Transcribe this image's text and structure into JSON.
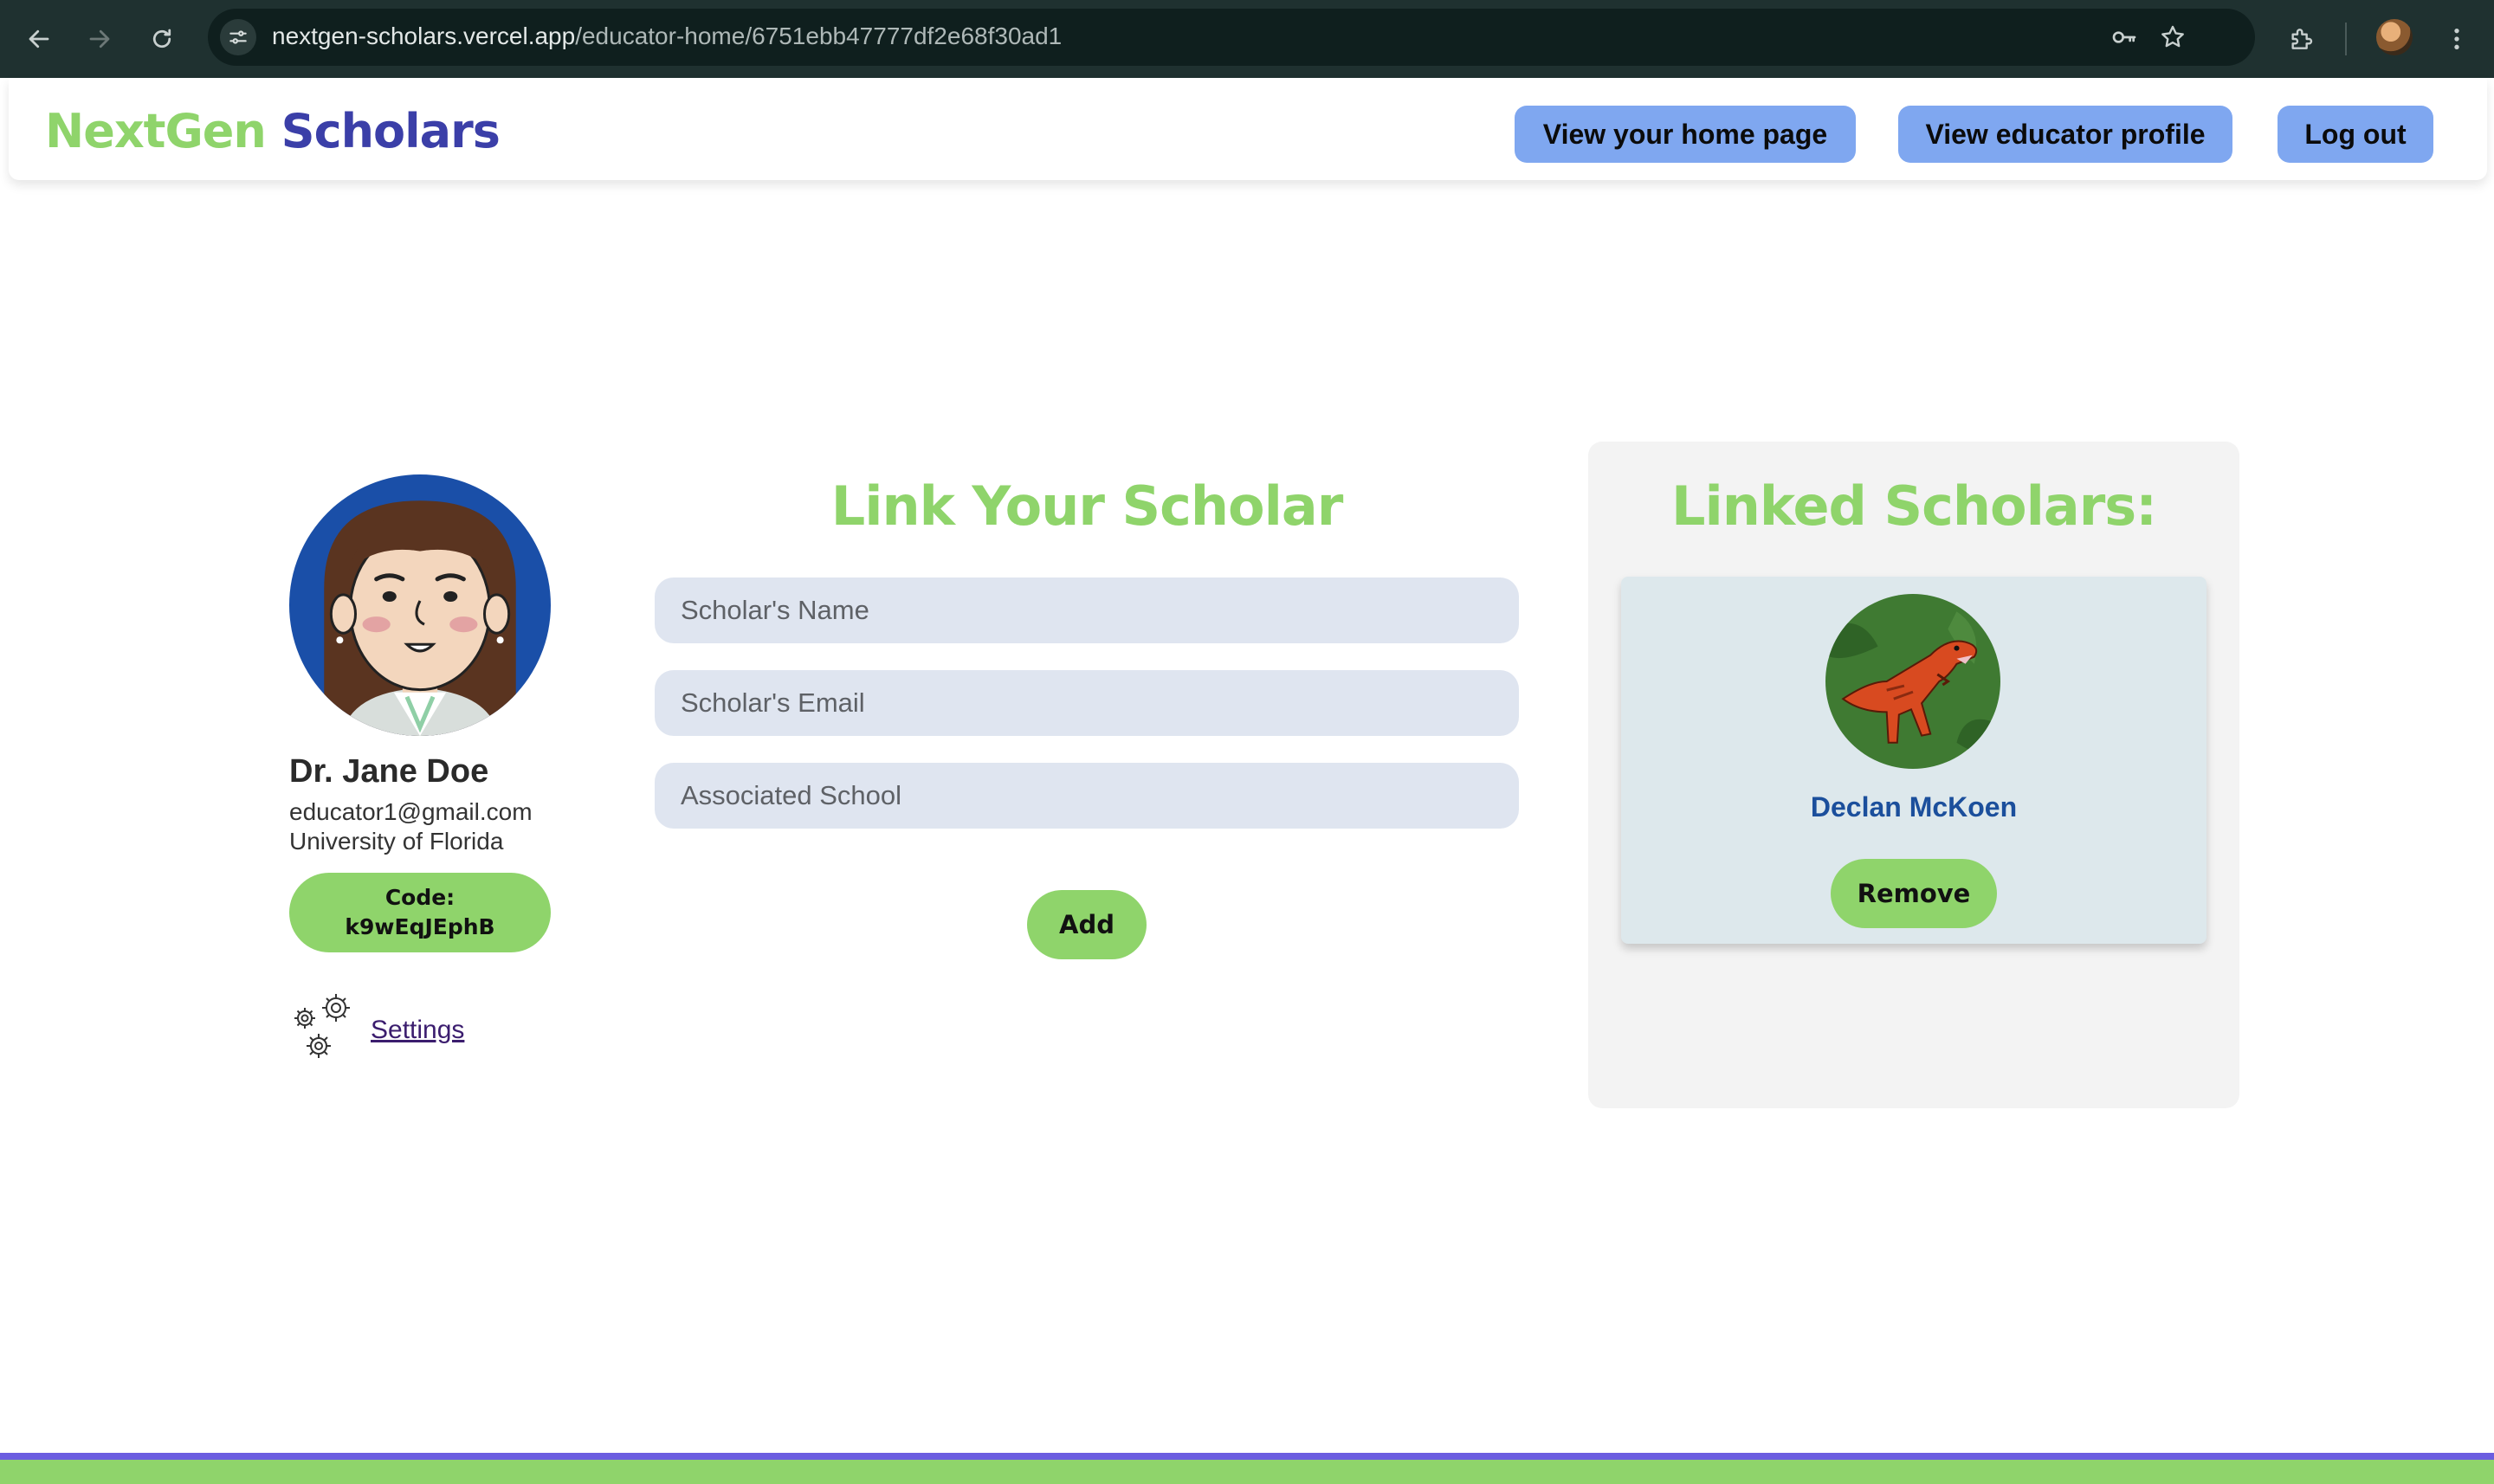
{
  "browser": {
    "url_host": "nextgen-scholars.vercel.app",
    "url_path": "/educator-home/6751ebb47777df2e68f30ad1"
  },
  "header": {
    "logo_part1": "NextGen",
    "logo_part2": "Scholars",
    "home_button": "View your home page",
    "profile_button": "View educator profile",
    "logout_button": "Log out"
  },
  "educator": {
    "name": "Dr. Jane Doe",
    "email": "educator1@gmail.com",
    "school": "University of Florida",
    "code_label": "Code:",
    "code_value": "k9wEqJEphB",
    "settings_label": " Settings"
  },
  "link_form": {
    "title": "Link Your Scholar",
    "name_placeholder": "Scholar's Name",
    "email_placeholder": "Scholar's Email",
    "school_placeholder": "Associated School",
    "add_button": "Add"
  },
  "linked": {
    "title": "Linked Scholars:",
    "scholars": [
      {
        "name": "Declan McKoen",
        "remove_label": "Remove"
      }
    ]
  },
  "colors": {
    "accent_green": "#8fd46b",
    "brand_blue": "#3b3fa8",
    "button_blue": "#7fa7f0",
    "footer_purple": "#6b5de0"
  }
}
